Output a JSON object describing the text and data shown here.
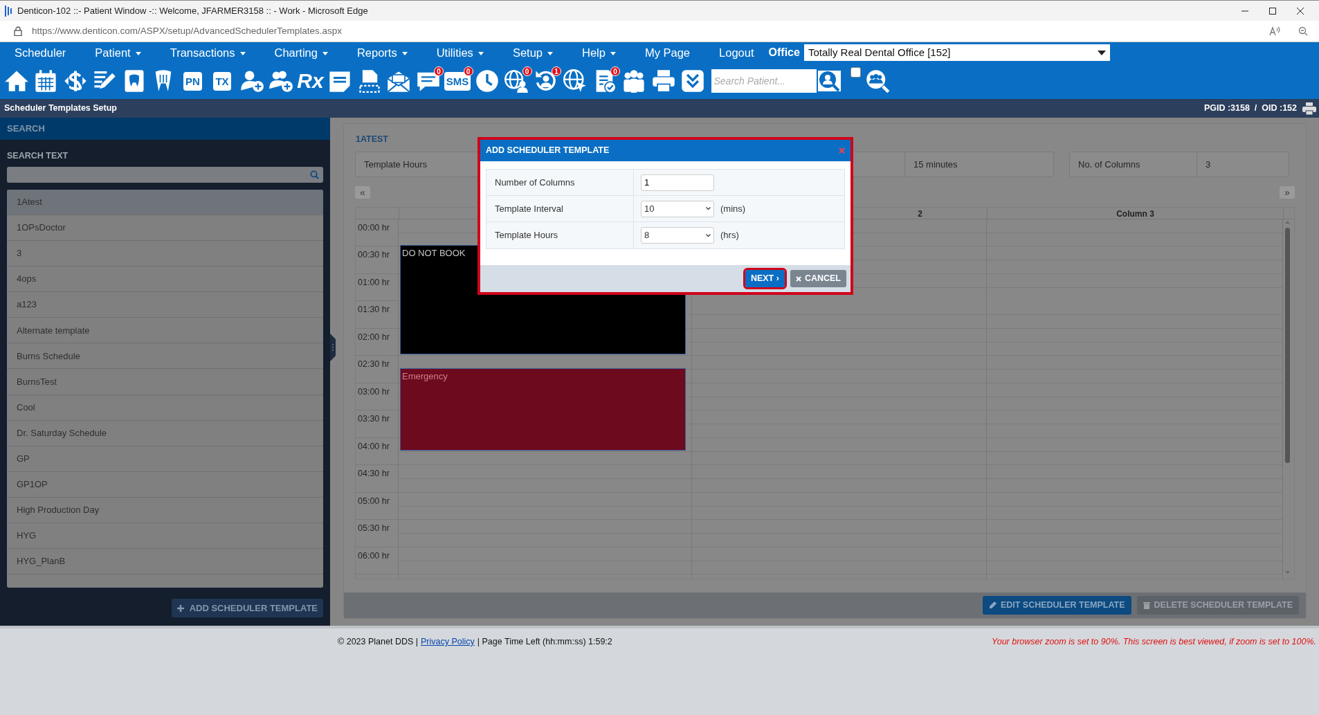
{
  "browser": {
    "title": "Denticon-102 ::- Patient Window -:: Welcome, JFARMER3158 :: - Work - Microsoft Edge",
    "url": "https://www.denticon.com/ASPX/setup/AdvancedSchedulerTemplates.aspx"
  },
  "menu": [
    {
      "label": "Scheduler",
      "dropdown": false
    },
    {
      "label": "Patient",
      "dropdown": true
    },
    {
      "label": "Transactions",
      "dropdown": true
    },
    {
      "label": "Charting",
      "dropdown": true
    },
    {
      "label": "Reports",
      "dropdown": true
    },
    {
      "label": "Utilities",
      "dropdown": true
    },
    {
      "label": "Setup",
      "dropdown": true
    },
    {
      "label": "Help",
      "dropdown": true
    },
    {
      "label": "My Page",
      "dropdown": false
    },
    {
      "label": "Logout",
      "dropdown": false
    }
  ],
  "office": {
    "label": "Office",
    "value": "Totally Real Dental Office [152]"
  },
  "toolbar": [
    {
      "kind": "icon"
    },
    {
      "kind": "icon"
    },
    {
      "kind": "icon"
    },
    {
      "kind": "icon"
    },
    {
      "kind": "icon"
    },
    {
      "kind": "icon"
    },
    {
      "kind": "tag",
      "label": "PN"
    },
    {
      "kind": "tag",
      "label": "TX"
    },
    {
      "kind": "icon"
    },
    {
      "kind": "icon"
    },
    {
      "kind": "glyph",
      "label": "Rx"
    },
    {
      "kind": "icon"
    },
    {
      "kind": "icon"
    },
    {
      "kind": "icon"
    },
    {
      "kind": "icon",
      "badge": "0"
    },
    {
      "kind": "tag",
      "label": "SMS",
      "badge": "0"
    },
    {
      "kind": "icon"
    },
    {
      "kind": "icon",
      "badge": "0"
    },
    {
      "kind": "icon",
      "badge": "1"
    },
    {
      "kind": "icon"
    },
    {
      "kind": "icon",
      "badge": "0"
    },
    {
      "kind": "icon"
    },
    {
      "kind": "icon"
    },
    {
      "kind": "icon"
    }
  ],
  "patient_search": {
    "placeholder": "Search Patient...",
    "checked": false
  },
  "page_header": {
    "title": "Scheduler Templates Setup",
    "ids": "PGID :3158  /  OID :152"
  },
  "sidebar": {
    "header": "SEARCH",
    "search_label": "SEARCH TEXT",
    "add_button": "ADD SCHEDULER TEMPLATE",
    "items": [
      {
        "label": "1Atest",
        "selected": true
      },
      {
        "label": "1OPsDoctor",
        "selected": false
      },
      {
        "label": "3",
        "selected": false
      },
      {
        "label": "4ops",
        "selected": false
      },
      {
        "label": "a123",
        "selected": false
      },
      {
        "label": "Alternate template",
        "selected": false
      },
      {
        "label": "Burns Schedule",
        "selected": false
      },
      {
        "label": "BurnsTest",
        "selected": false
      },
      {
        "label": "Cool",
        "selected": false
      },
      {
        "label": "Dr. Saturday Schedule",
        "selected": false
      },
      {
        "label": "GP",
        "selected": false
      },
      {
        "label": "GP1OP",
        "selected": false
      },
      {
        "label": "High Production Day",
        "selected": false
      },
      {
        "label": "HYG",
        "selected": false
      },
      {
        "label": "HYG_PlanB",
        "selected": false
      }
    ]
  },
  "template": {
    "name": "1ATEST",
    "summary": [
      {
        "cells": [
          "Template Hours",
          "15 minutes"
        ]
      },
      {
        "cells": [
          "No. of Columns",
          "3"
        ]
      }
    ],
    "prev": "«",
    "next": "»",
    "times": [
      "00:00 hr",
      "00:30 hr",
      "01:00 hr",
      "01:30 hr",
      "02:00 hr",
      "02:30 hr",
      "03:00 hr",
      "03:30 hr",
      "04:00 hr",
      "04:30 hr",
      "05:00 hr",
      "05:30 hr",
      "06:00 hr"
    ],
    "columns": [
      {
        "slots": [
          {
            "kind": "empty"
          },
          {
            "kind": "empty"
          },
          {
            "kind": "event",
            "label": "DO NOT BOOK",
            "color": "#000000"
          },
          {
            "kind": "continued"
          },
          {
            "kind": "continued"
          },
          {
            "kind": "continued"
          },
          {
            "kind": "continued"
          },
          {
            "kind": "continued"
          },
          {
            "kind": "continued"
          },
          {
            "kind": "continued"
          },
          {
            "kind": "empty"
          },
          {
            "kind": "event",
            "label": "Emergency",
            "color": "#6d0a1e"
          },
          {
            "kind": "continued"
          },
          {
            "kind": "continued"
          },
          {
            "kind": "continued"
          },
          {
            "kind": "continued"
          },
          {
            "kind": "continued"
          },
          {
            "kind": "empty"
          }
        ]
      },
      {
        "header": "2"
      },
      {
        "header": "Column 3"
      }
    ],
    "actions": [
      {
        "label": "EDIT SCHEDULER TEMPLATE",
        "kind": "edit",
        "disabled": false
      },
      {
        "label": "DELETE SCHEDULER TEMPLATE",
        "kind": "delete",
        "disabled": true
      }
    ]
  },
  "dialog": {
    "title": "ADD SCHEDULER TEMPLATE",
    "fields": [
      {
        "label": "Number of Columns",
        "kind": "input",
        "value": "1"
      },
      {
        "label": "Template Interval",
        "kind": "select",
        "value": "10",
        "unit": "(mins)"
      },
      {
        "label": "Template Hours",
        "kind": "select",
        "value": "8",
        "unit": "(hrs)"
      }
    ],
    "buttons": [
      {
        "label": "NEXT ›",
        "kind": "primary",
        "focused": true
      },
      {
        "label": "CANCEL",
        "kind": "secondary",
        "focused": false
      }
    ]
  },
  "footer": {
    "parts": [
      {
        "kind": "text",
        "text": "© 2023 Planet DDS |"
      },
      {
        "kind": "link",
        "text": "Privacy Policy"
      },
      {
        "kind": "text",
        "text": "| Page Time Left (hh:mm:ss) 1:59:2"
      }
    ],
    "warning": "Your browser zoom is set to 90%. This screen is best viewed, if zoom is set to 100%."
  }
}
